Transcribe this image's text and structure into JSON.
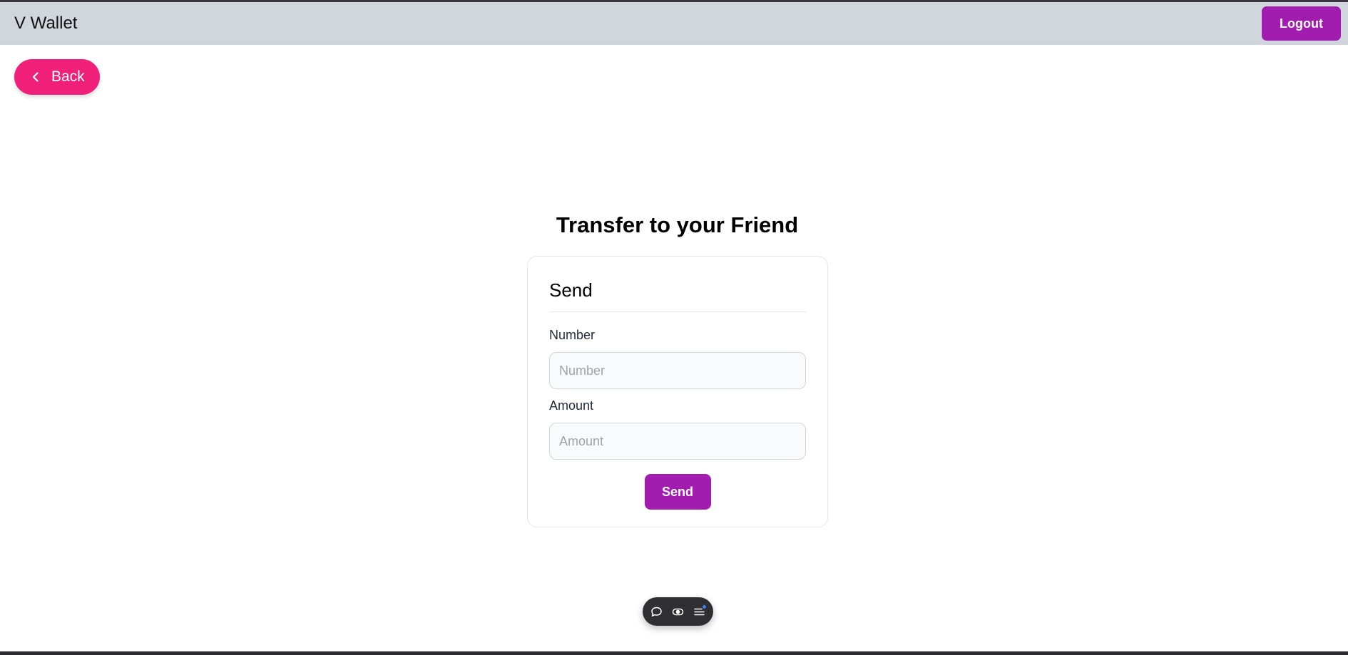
{
  "navbar": {
    "brand": "V Wallet",
    "logout_label": "Logout"
  },
  "back_button": {
    "label": "Back",
    "icon": "chevron-left-icon"
  },
  "page": {
    "title": "Transfer to your Friend"
  },
  "card": {
    "title": "Send",
    "number_label": "Number",
    "number_placeholder": "Number",
    "number_value": "",
    "amount_label": "Amount",
    "amount_placeholder": "Amount",
    "amount_value": "",
    "send_label": "Send"
  },
  "toolbar": {
    "icons": [
      "chat-bubble-icon",
      "toggle-eye-icon",
      "menu-list-icon"
    ]
  },
  "colors": {
    "accent_purple": "#a21caf",
    "back_pink": "#f0207a",
    "navbar_bg": "#d1d5dc",
    "toolbar_bg": "#2f2f33",
    "notify_blue": "#3b82f6"
  }
}
